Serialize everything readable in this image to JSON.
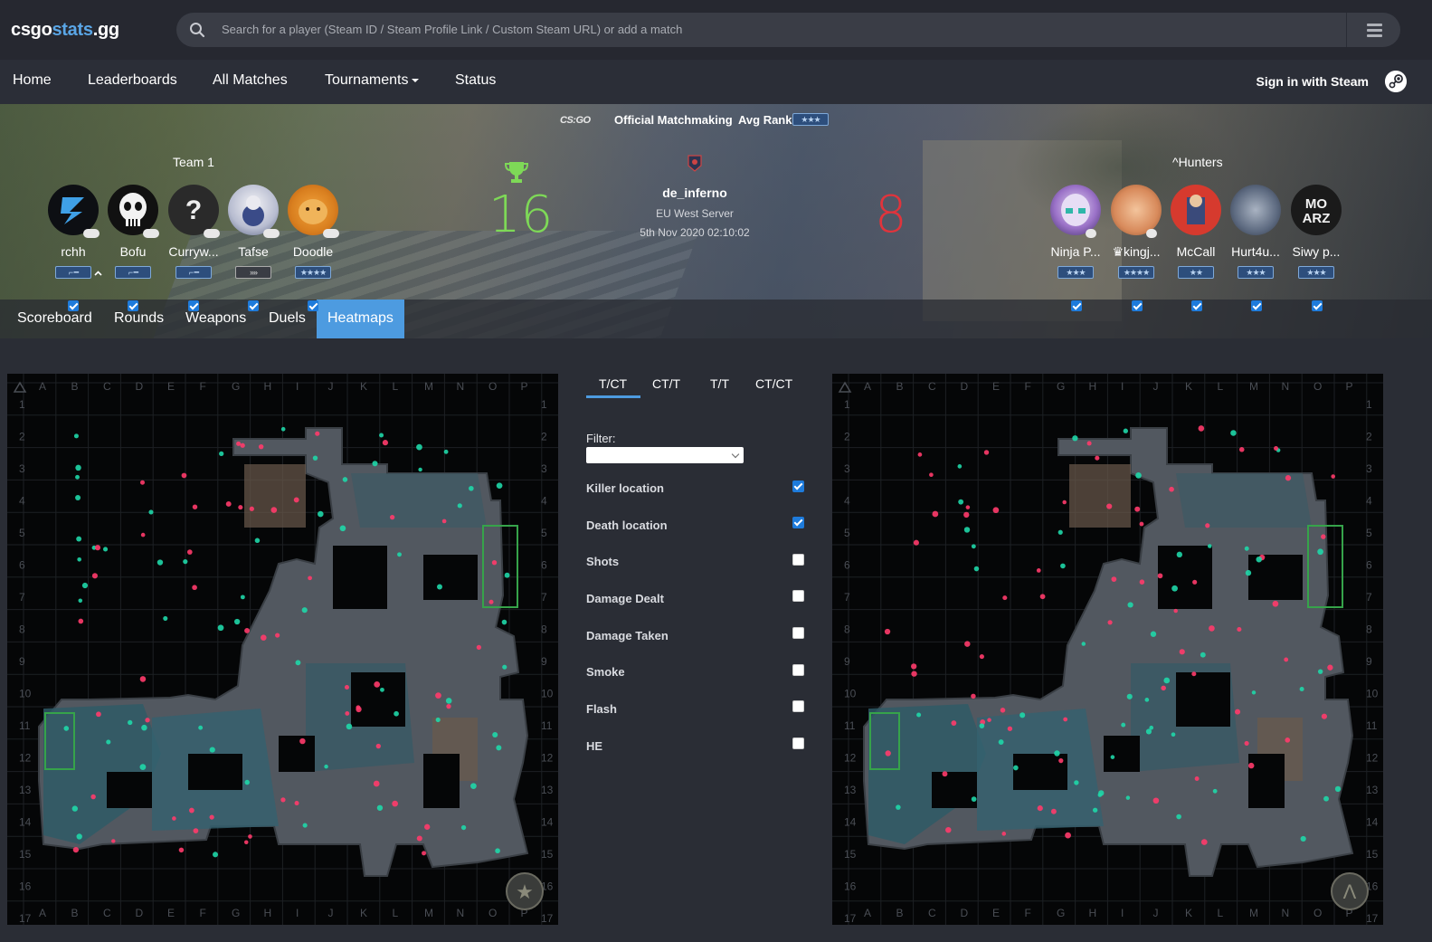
{
  "header": {
    "logo_main": "csgo",
    "logo_accent": "stats",
    "logo_tail": ".gg",
    "search_placeholder": "Search for a player (Steam ID / Steam Profile Link / Custom Steam URL) or add a match",
    "search_icon": "search-icon",
    "menu_icon": "server-list-icon"
  },
  "nav": {
    "items": [
      "Home",
      "Leaderboards",
      "All Matches",
      "Tournaments",
      "Status"
    ],
    "signin": "Sign in with Steam"
  },
  "match": {
    "game_logo": "CS:GO",
    "type": "Official Matchmaking",
    "avg_rank_label": "Avg Rank:",
    "map": "de_inferno",
    "server": "EU West Server",
    "date": "5th Nov 2020 02:10:02",
    "team1": {
      "name": "Team 1",
      "score": "16",
      "players": [
        "rchh",
        "Bofu",
        "Curryw...",
        "Tafse",
        "Doodle"
      ]
    },
    "team2": {
      "name": "^Hunters",
      "score": "8",
      "players": [
        "Ninja P...",
        "♛kingj...",
        "McCall",
        "Hurt4u...",
        "Siwy p..."
      ]
    }
  },
  "tabs": [
    "Scoreboard",
    "Rounds",
    "Weapons",
    "Duels",
    "Heatmaps"
  ],
  "active_tab": "Heatmaps",
  "heatmap": {
    "side_tabs": [
      "T/CT",
      "CT/T",
      "T/T",
      "CT/CT"
    ],
    "active_side": "T/CT",
    "filter_label": "Filter:",
    "filter_value": "",
    "options": [
      {
        "label": "Killer location",
        "checked": true
      },
      {
        "label": "Death location",
        "checked": true
      },
      {
        "label": "Shots",
        "checked": false
      },
      {
        "label": "Damage Dealt",
        "checked": false
      },
      {
        "label": "Damage Taken",
        "checked": false
      },
      {
        "label": "Smoke",
        "checked": false
      },
      {
        "label": "Flash",
        "checked": false
      },
      {
        "label": "HE",
        "checked": false
      }
    ],
    "grid_cols": [
      "A",
      "B",
      "C",
      "D",
      "E",
      "F",
      "G",
      "H",
      "I",
      "J",
      "K",
      "L",
      "M",
      "N",
      "O",
      "P"
    ],
    "grid_rows": [
      "1",
      "2",
      "3",
      "4",
      "5",
      "6",
      "7",
      "8",
      "9",
      "10",
      "11",
      "12",
      "13",
      "14",
      "15",
      "16",
      "17"
    ],
    "left_badge": "t-side-emblem-icon",
    "right_badge": "ct-side-emblem-icon"
  },
  "colors": {
    "accent": "#4d9be0",
    "win_score": "#7ed957",
    "loss_score": "#e0343c",
    "killer_marker": "#1fd7a8",
    "death_marker": "#ff3b6b"
  }
}
